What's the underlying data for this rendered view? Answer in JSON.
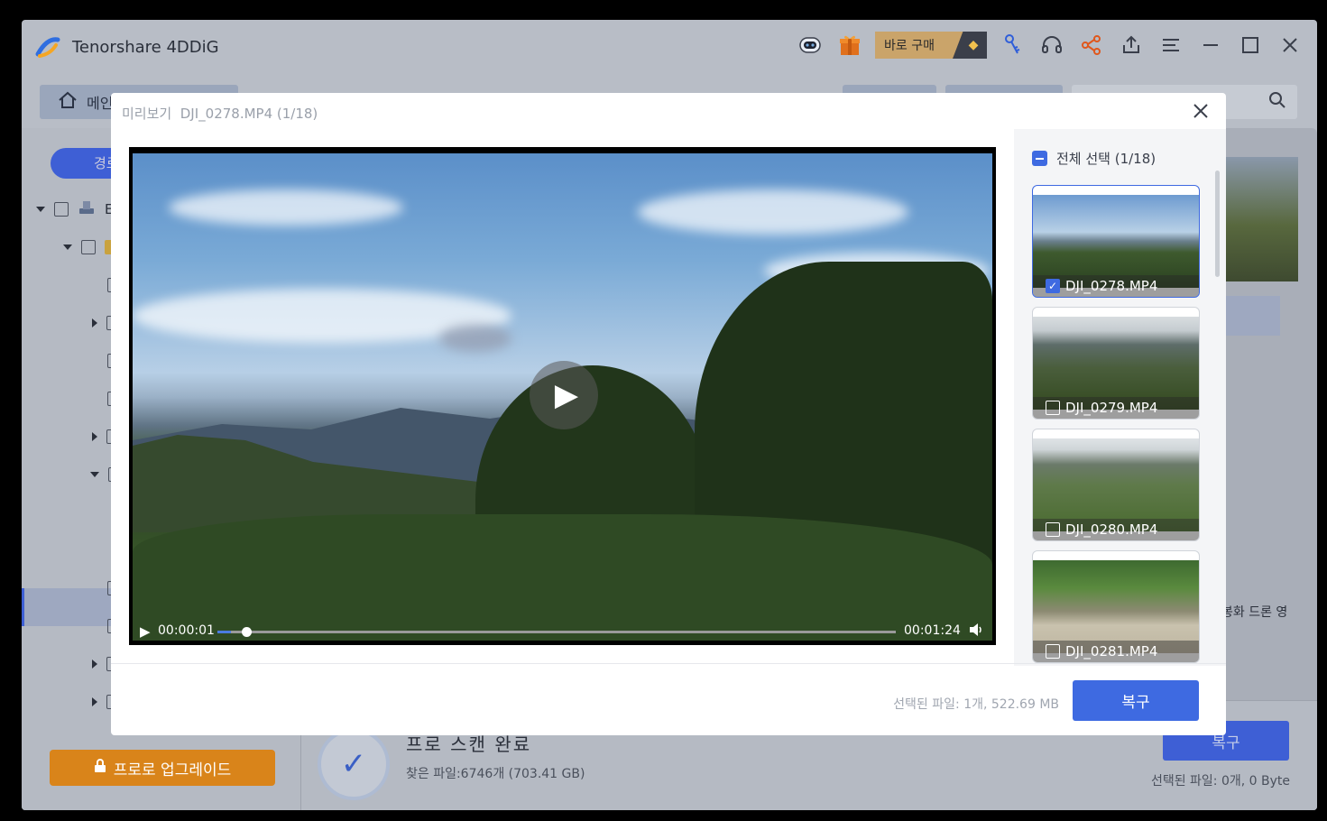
{
  "app": {
    "title": "Tenorshare 4DDiG",
    "buy_label": "바로 구매"
  },
  "toolbar": {
    "icons": [
      "robot-icon",
      "gift-icon",
      "key-icon",
      "headset-icon",
      "share-icon",
      "upload-icon",
      "menu-icon",
      "minimize-icon",
      "maximize-icon",
      "close-icon"
    ]
  },
  "nav": {
    "home_label": "메인"
  },
  "sidebar": {
    "pill_label": "경로",
    "root_label": "E",
    "upgrade_label": "프로로 업그레이드"
  },
  "background": {
    "scan_title": "프로 스캔 완료",
    "scan_sub": "찾은 파일:6746개 (703.41 GB)",
    "recover_label": "복구",
    "selected_info": "선택된 파일: 0개, 0 Byte",
    "side_text": "봉화 드론 영"
  },
  "modal": {
    "title": "미리보기",
    "file_info": "DJI_0278.MP4 (1/18)",
    "select_all": "전체 선택 (1/18)",
    "player": {
      "current_time": "00:00:01",
      "total_time": "00:01:24",
      "progress": 0.02
    },
    "thumbs": [
      {
        "name": "DJI_0278.MP4",
        "checked": true
      },
      {
        "name": "DJI_0279.MP4",
        "checked": false
      },
      {
        "name": "DJI_0280.MP4",
        "checked": false
      },
      {
        "name": "DJI_0281.MP4",
        "checked": false
      }
    ],
    "footer_info": "선택된 파일: 1개, 522.69 MB",
    "recover_label": "복구"
  },
  "colors": {
    "accent": "#3e6ae1",
    "upgrade": "#d9841a"
  }
}
